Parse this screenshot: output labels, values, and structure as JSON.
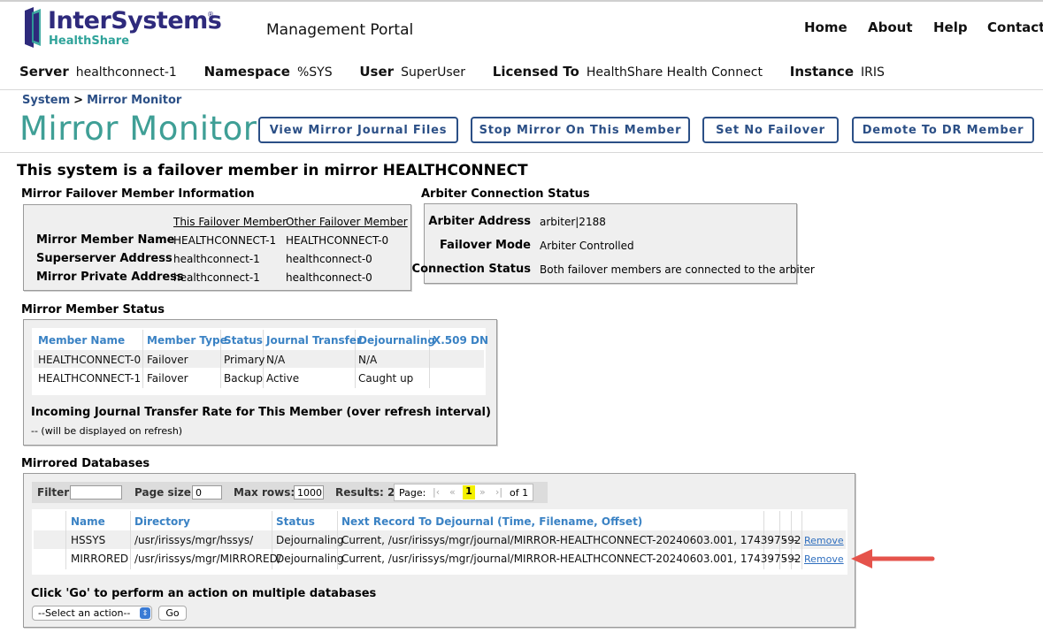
{
  "brand": {
    "name": "InterSystems",
    "reg": "®",
    "product": "HealthShare"
  },
  "header": {
    "portal_title": "Management Portal",
    "nav": [
      "Home",
      "About",
      "Help",
      "Contact"
    ]
  },
  "infobar": [
    {
      "label": "Server",
      "value": "healthconnect-1"
    },
    {
      "label": "Namespace",
      "value": "%SYS"
    },
    {
      "label": "User",
      "value": "SuperUser"
    },
    {
      "label": "Licensed To",
      "value": "HealthShare Health Connect"
    },
    {
      "label": "Instance",
      "value": "IRIS"
    }
  ],
  "breadcrumb": {
    "root": "System",
    "sep": ">",
    "current": "Mirror Monitor"
  },
  "page_title": "Mirror Monitor",
  "actions": [
    "View Mirror Journal Files",
    "Stop Mirror On This Member",
    "Set No Failover",
    "Demote To DR Member"
  ],
  "summary": "This system is a failover member in mirror HEALTHCONNECT",
  "failover_info": {
    "title": "Mirror Failover Member Information",
    "col_this": "This Failover Member",
    "col_other": "Other Failover Member",
    "rows": [
      {
        "label": "Mirror Member Name",
        "this": "HEALTHCONNECT-1",
        "other": "HEALTHCONNECT-0"
      },
      {
        "label": "Superserver Address",
        "this": "healthconnect-1",
        "other": "healthconnect-0"
      },
      {
        "label": "Mirror Private Address",
        "this": "healthconnect-1",
        "other": "healthconnect-0"
      }
    ]
  },
  "arbiter": {
    "title": "Arbiter Connection Status",
    "rows": [
      {
        "label": "Arbiter Address",
        "value": "arbiter|2188"
      },
      {
        "label": "Failover Mode",
        "value": "Arbiter Controlled"
      },
      {
        "label": "Connection Status",
        "value": "Both failover members are connected to the arbiter"
      }
    ]
  },
  "member_status": {
    "title": "Mirror Member Status",
    "headers": [
      "Member Name",
      "Member Type",
      "Status",
      "Journal Transfer",
      "Dejournaling",
      "X.509 DN"
    ],
    "rows": [
      [
        "HEALTHCONNECT-0",
        "Failover",
        "Primary",
        "N/A",
        "N/A",
        ""
      ],
      [
        "HEALTHCONNECT-1",
        "Failover",
        "Backup",
        "Active",
        "Caught up",
        ""
      ]
    ],
    "rate_title": "Incoming Journal Transfer Rate for This Member (over refresh interval)",
    "rate_value": "-- (will be displayed on refresh)"
  },
  "databases": {
    "title": "Mirrored Databases",
    "filter_label": "Filter:",
    "filter_value": "",
    "page_size_label": "Page size:",
    "page_size_value": "0",
    "max_rows_label": "Max rows:",
    "max_rows_value": "1000",
    "results_label": "Results: 2",
    "pager_label": "Page:",
    "pager_current": "1",
    "pager_of": "of 1",
    "headers": [
      "Name",
      "Directory",
      "Status",
      "Next Record To Dejournal (Time, Filename, Offset)"
    ],
    "rows": [
      {
        "name": "HSSYS",
        "dir": "/usr/irissys/mgr/hssys/",
        "status": "Dejournaling",
        "next": "Current, /usr/irissys/mgr/journal/MIRROR-HEALTHCONNECT-20240603.001, 174397592",
        "c1": "-",
        "c2": "-",
        "c3": "-",
        "action": "Remove"
      },
      {
        "name": "MIRRORED",
        "dir": "/usr/irissys/mgr/MIRRORED/",
        "status": "Dejournaling",
        "next": "Current, /usr/irissys/mgr/journal/MIRROR-HEALTHCONNECT-20240603.001, 174397592",
        "c1": "-",
        "c2": "-",
        "c3": "-",
        "action": "Remove"
      }
    ],
    "multi_action_label": "Click 'Go' to perform an action on multiple databases",
    "select_value": "--Select an action--",
    "go_label": "Go"
  },
  "colors": {
    "brand_navy": "#2e2a7c",
    "brand_teal": "#3f9f96",
    "link_blue": "#2b4f86",
    "header_blue": "#3a82c4",
    "annotation_red": "#e5534b"
  }
}
